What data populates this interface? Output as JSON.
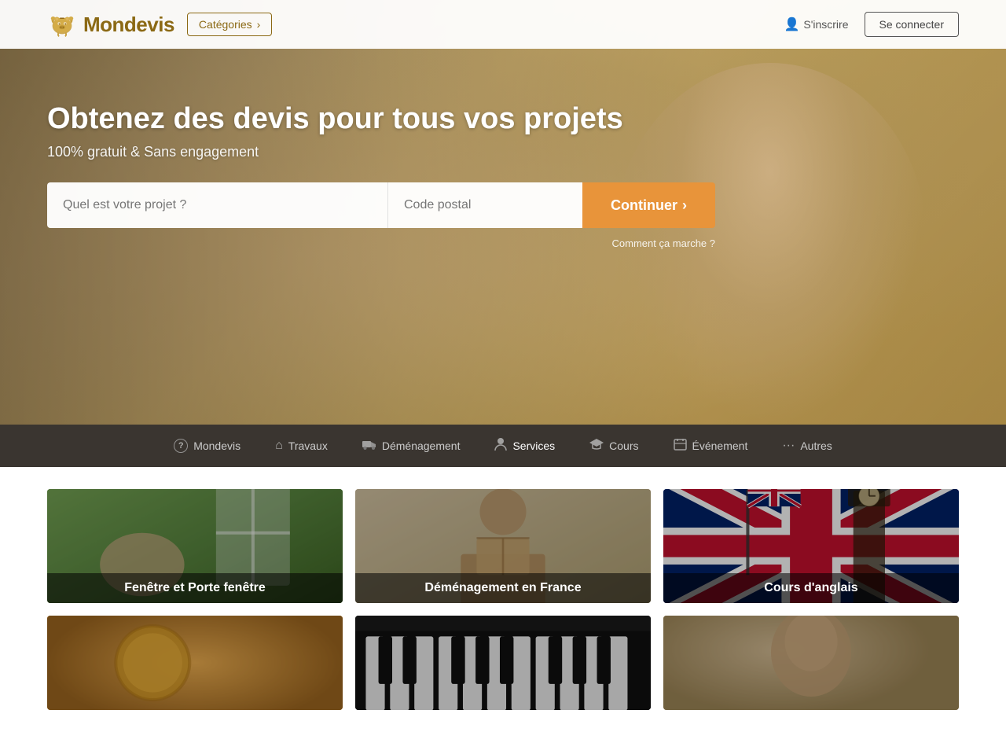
{
  "header": {
    "logo_text": "Mondevis",
    "categories_label": "Catégories",
    "categories_arrow": "›",
    "signin_label": "S'inscrire",
    "connect_label": "Se connecter"
  },
  "hero": {
    "title": "Obtenez des devis pour tous vos projets",
    "subtitle": "100% gratuit & Sans engagement",
    "search_project_placeholder": "Quel est votre projet ?",
    "search_postal_placeholder": "Code postal",
    "search_btn_label": "Continuer",
    "search_btn_arrow": "›",
    "how_it_works": "Comment ça marche ?"
  },
  "nav": {
    "items": [
      {
        "id": "mondevis",
        "label": "Mondevis",
        "icon": "?"
      },
      {
        "id": "travaux",
        "label": "Travaux",
        "icon": "⌂"
      },
      {
        "id": "demenagement",
        "label": "Déménagement",
        "icon": "⬛"
      },
      {
        "id": "services",
        "label": "Services",
        "icon": "👤"
      },
      {
        "id": "cours",
        "label": "Cours",
        "icon": "🎓"
      },
      {
        "id": "evenement",
        "label": "Événement",
        "icon": "📅"
      },
      {
        "id": "autres",
        "label": "Autres",
        "icon": "···"
      }
    ]
  },
  "cards": {
    "items": [
      {
        "id": "fenetre",
        "label": "Fenêtre et Porte fenêtre",
        "bg": "1"
      },
      {
        "id": "demenagement",
        "label": "Déménagement en France",
        "bg": "2"
      },
      {
        "id": "anglais",
        "label": "Cours d'anglais",
        "bg": "3"
      },
      {
        "id": "card4",
        "label": "",
        "bg": "4"
      },
      {
        "id": "card5",
        "label": "",
        "bg": "5"
      },
      {
        "id": "card6",
        "label": "",
        "bg": "6"
      }
    ]
  }
}
